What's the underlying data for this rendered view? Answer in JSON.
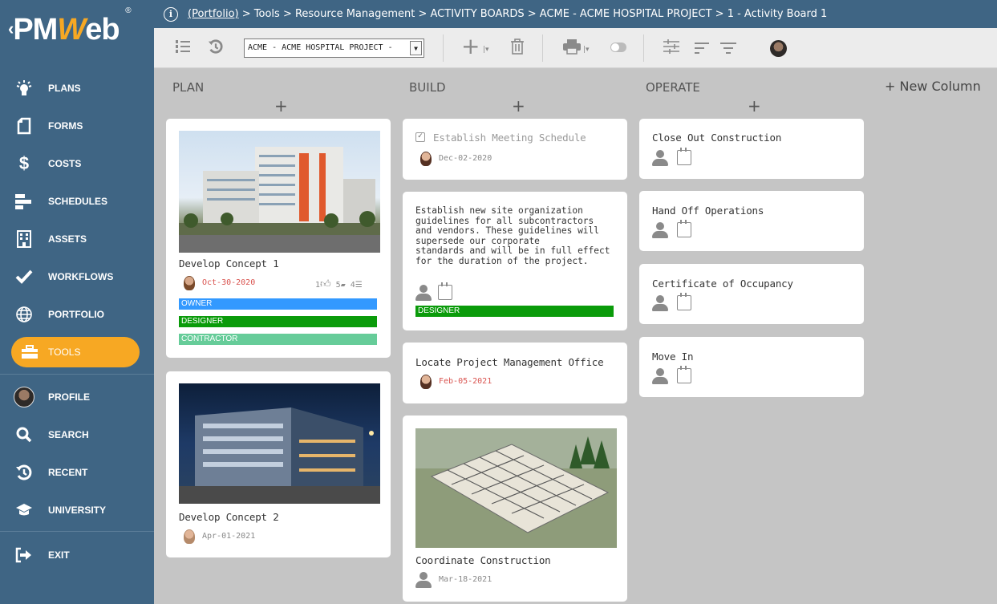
{
  "app": {
    "logo_text": "PMWeb",
    "logo_prefix": "PM",
    "logo_w": "W",
    "logo_suffix": "eb"
  },
  "breadcrumb": {
    "link": "(Portfolio)",
    "rest": " > Tools > Resource Management > ACTIVITY BOARDS > ACME - ACME HOSPITAL PROJECT > 1 - Activity Board 1"
  },
  "toolbar": {
    "project_select_value": "ACME - ACME HOSPITAL PROJECT -"
  },
  "sidebar": {
    "items": [
      {
        "label": "PLANS",
        "icon": "lightbulb-icon"
      },
      {
        "label": "FORMS",
        "icon": "form-icon"
      },
      {
        "label": "COSTS",
        "icon": "dollar-icon"
      },
      {
        "label": "SCHEDULES",
        "icon": "schedule-icon"
      },
      {
        "label": "ASSETS",
        "icon": "building-icon"
      },
      {
        "label": "WORKFLOWS",
        "icon": "check-icon"
      },
      {
        "label": "PORTFOLIO",
        "icon": "globe-icon"
      },
      {
        "label": "TOOLS",
        "icon": "toolbox-icon"
      },
      {
        "label": "PROFILE",
        "icon": "avatar"
      },
      {
        "label": "SEARCH",
        "icon": "search-icon"
      },
      {
        "label": "RECENT",
        "icon": "history-icon"
      },
      {
        "label": "UNIVERSITY",
        "icon": "graduation-cap-icon"
      },
      {
        "label": "EXIT",
        "icon": "exit-icon"
      }
    ]
  },
  "board": {
    "new_column_label": "+ New Column",
    "columns": [
      {
        "title": "PLAN",
        "cards": [
          {
            "title": "Develop Concept 1",
            "date": "Oct-30-2020",
            "likes": "1",
            "comments": "5",
            "attachments": "4",
            "tags": [
              "OWNER",
              "DESIGNER",
              "CONTRACTOR"
            ]
          },
          {
            "title": "Develop Concept 2",
            "date": "Apr-01-2021"
          }
        ]
      },
      {
        "title": "BUILD",
        "cards": [
          {
            "title": "Establish Meeting Schedule",
            "date": "Dec-02-2020"
          },
          {
            "description": [
              "Establish new site organization",
              "guidelines for all subcontractors",
              "and vendors. These guidelines will",
              "supersede our corporate",
              "standards and will be in full effect",
              "for the duration of the project."
            ],
            "tags": [
              "DESIGNER"
            ]
          },
          {
            "title": "Locate Project Management Office",
            "date": "Feb-05-2021"
          },
          {
            "title": "Coordinate Construction",
            "date": "Mar-18-2021"
          }
        ]
      },
      {
        "title": "OPERATE",
        "cards": [
          {
            "title": "Close Out Construction"
          },
          {
            "title": "Hand Off Operations"
          },
          {
            "title": "Certificate of Occupancy"
          },
          {
            "title": "Move In"
          }
        ]
      }
    ]
  },
  "colors": {
    "sidebar_bg": "#3f6584",
    "active_nav": "#f7a823",
    "tag_owner": "#3399ff",
    "tag_designer": "#0a9b0a",
    "tag_contractor": "#66cc99",
    "overdue_date": "#d9534f"
  }
}
